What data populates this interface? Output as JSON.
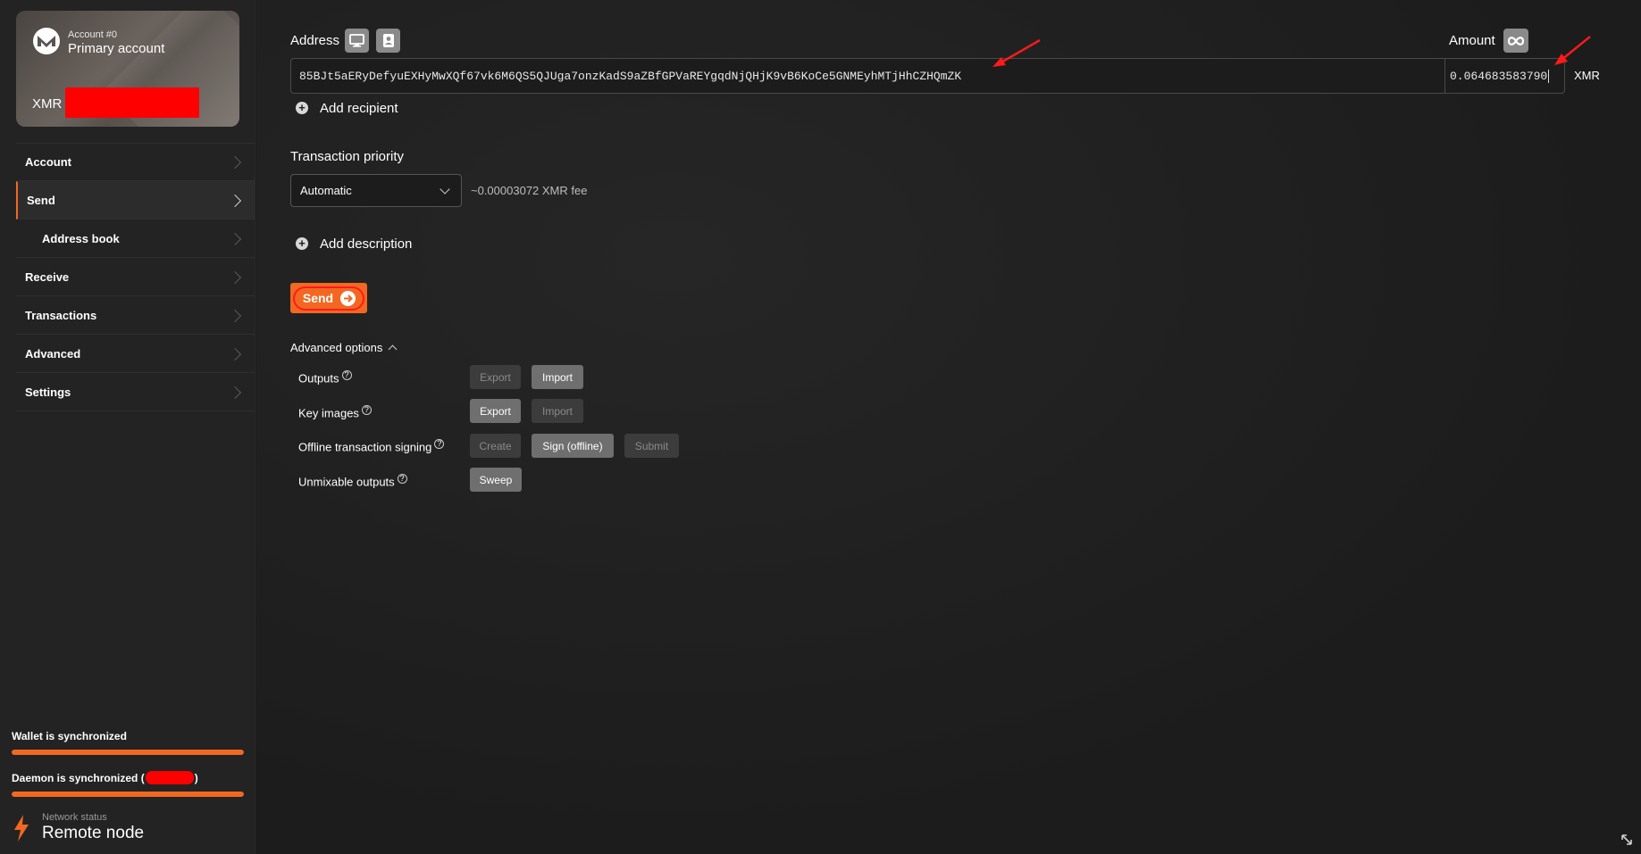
{
  "account": {
    "number": "Account #0",
    "name": "Primary account",
    "currency": "XMR"
  },
  "menu": {
    "items": [
      {
        "label": "Account"
      },
      {
        "label": "Send"
      },
      {
        "label": "Address book"
      },
      {
        "label": "Receive"
      },
      {
        "label": "Transactions"
      },
      {
        "label": "Advanced"
      },
      {
        "label": "Settings"
      }
    ]
  },
  "status": {
    "wallet": "Wallet is synchronized",
    "wallet_progress": 1.0,
    "daemon_prefix": "Daemon is synchronized (",
    "daemon_suffix": ")",
    "daemon_progress": 1.0,
    "network_label": "Network status",
    "network_value": "Remote node"
  },
  "send": {
    "address_label": "Address",
    "amount_label": "Amount",
    "address_value": "85BJt5aERyDefyuEXHyMwXQf67vk6M6QS5QJUga7onzKadS9aZBfGPVaREYgqdNjQHjK9vB6KoCe5GNMEyhMTjHhCZHQmZK",
    "amount_value": "0.064683583790",
    "unit": "XMR",
    "add_recipient": "Add recipient",
    "priority_label": "Transaction priority",
    "priority_value": "Automatic",
    "fee": "~0.00003072 XMR fee",
    "add_description": "Add description",
    "send_label": "Send"
  },
  "advanced": {
    "title": "Advanced options",
    "rows": [
      {
        "label": "Outputs",
        "buttons": [
          "Export",
          "Import"
        ]
      },
      {
        "label": "Key images",
        "buttons": [
          "Export",
          "Import"
        ]
      },
      {
        "label": "Offline transaction signing",
        "buttons": [
          "Create",
          "Sign (offline)",
          "Submit"
        ]
      },
      {
        "label": "Unmixable outputs",
        "buttons": [
          "Sweep"
        ]
      }
    ],
    "help_glyph": "?"
  },
  "colors": {
    "accent": "#f26822",
    "background": "#1c1c1c",
    "sidebar": "#232323",
    "annotation": "#ff0000"
  },
  "icons": [
    "monero-logo-icon",
    "monitor-icon",
    "contact-book-icon",
    "infinity-icon",
    "plus-circle-icon",
    "chevron-right-icon",
    "chevron-down-icon",
    "chevron-up-icon",
    "arrow-right-icon",
    "lightning-icon",
    "resize-icon"
  ]
}
